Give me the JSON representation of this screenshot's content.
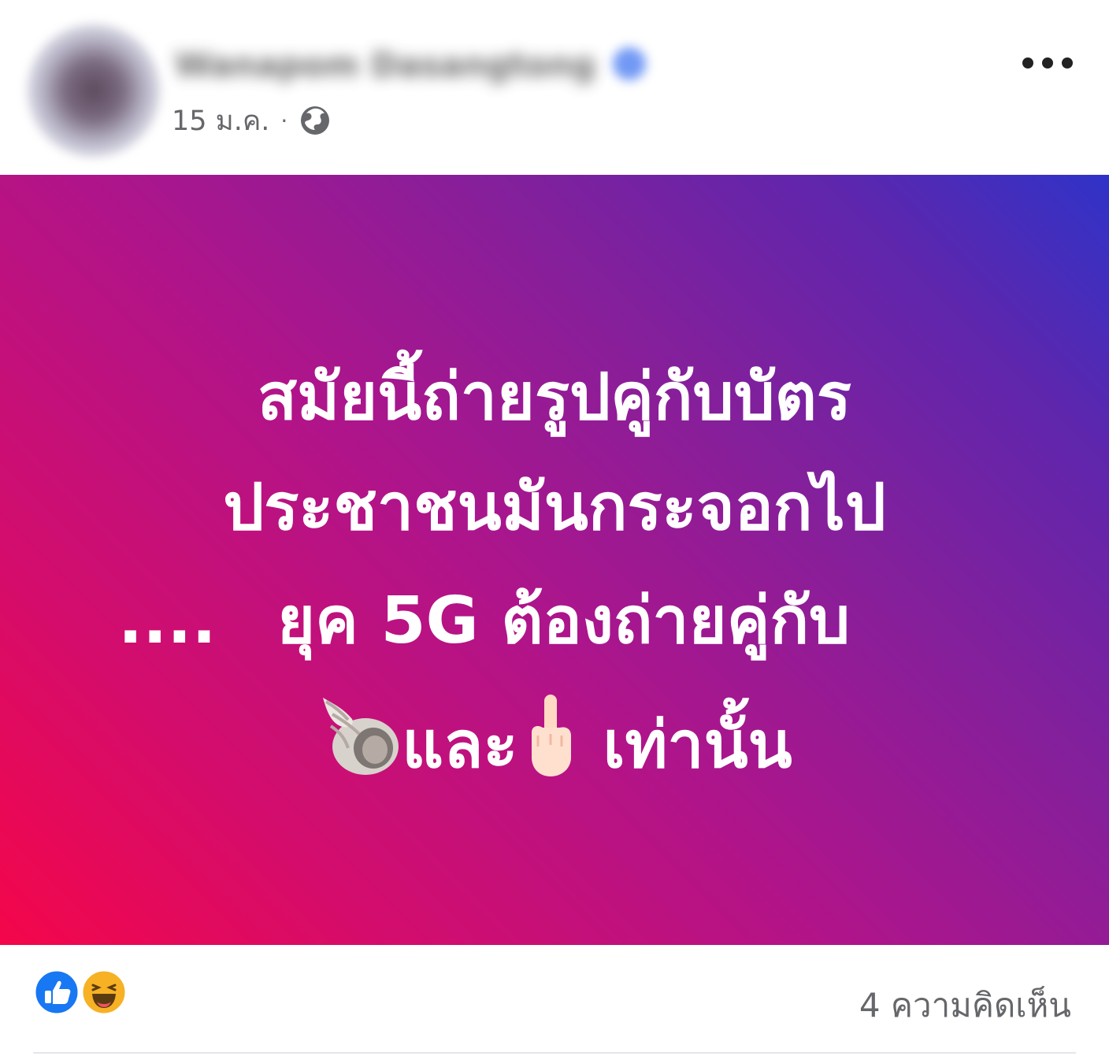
{
  "post": {
    "author": {
      "name": "Wanapom Dasangtong"
    },
    "timestamp": "15 ม.ค.",
    "meta_separator": "·",
    "visibility_icon": "globe-icon",
    "menu_icon": "more-icon"
  },
  "content": {
    "line_1": "สมัยนี้ถ่ายรูปคู่กับบัตร",
    "line_2": "ประชาชนมันกระจอกไป",
    "line_3_dots": "....",
    "line_3": "ยุค 5G ต้องถ่ายคู่กับ",
    "line_4_part_1": "และ",
    "line_4_part_2": "เท่านั้น",
    "emoji_1": "shell-icon",
    "emoji_2": "middle-finger-icon",
    "background_colors": [
      "#f4064a",
      "#b0148a",
      "#5e26ad",
      "#2f33c8"
    ]
  },
  "footer": {
    "reactions": [
      "like-icon",
      "haha-icon"
    ],
    "comment_count": "4 ความคิดเห็น"
  }
}
